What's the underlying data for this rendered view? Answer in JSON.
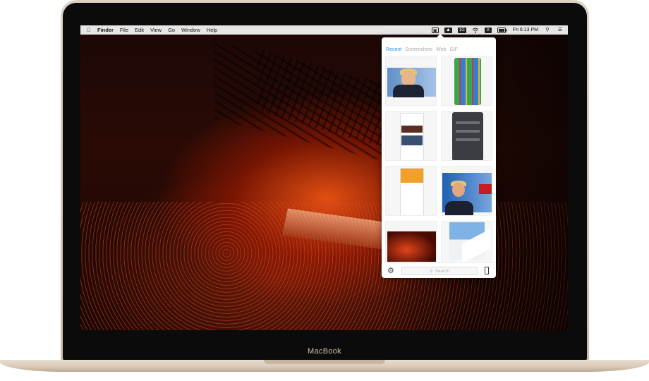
{
  "device": {
    "brand_label": "MacBook"
  },
  "menubar": {
    "apple_icon": "apple-logo-icon",
    "app_name": "Finder",
    "menus": [
      "File",
      "Edit",
      "View",
      "Go",
      "Window",
      "Help"
    ],
    "status": {
      "display_icon": "screen-mirror-icon",
      "app_icon": "image-gallery-icon",
      "badge_label": "1G",
      "wifi_icon": "wifi-icon",
      "input_label": "A",
      "battery_icon": "battery-icon",
      "clock": "Fri 6:13 PM",
      "search_icon": "spotlight-search-icon",
      "list_icon": "notification-center-icon"
    }
  },
  "popover": {
    "tabs": [
      {
        "label": "Recent",
        "active": true
      },
      {
        "label": "Screenshots",
        "active": false
      },
      {
        "label": "Web",
        "active": false
      },
      {
        "label": "GIF",
        "active": false
      }
    ],
    "thumbnails": [
      {
        "name": "trump-portrait"
      },
      {
        "name": "iphone-home-screen"
      },
      {
        "name": "web-page-layout"
      },
      {
        "name": "dark-settings-screen"
      },
      {
        "name": "orange-ui-screens"
      },
      {
        "name": "fox-news-trump"
      },
      {
        "name": "concert-crowd"
      },
      {
        "name": "white-architecture"
      }
    ],
    "footer": {
      "settings_icon": "gear-icon",
      "search_placeholder": "Search",
      "device_icon": "phone-icon"
    }
  },
  "colors": {
    "accent": "#2a8ce8",
    "menubar_bg": "#e8e6e4",
    "popover_bg": "#ffffff"
  }
}
